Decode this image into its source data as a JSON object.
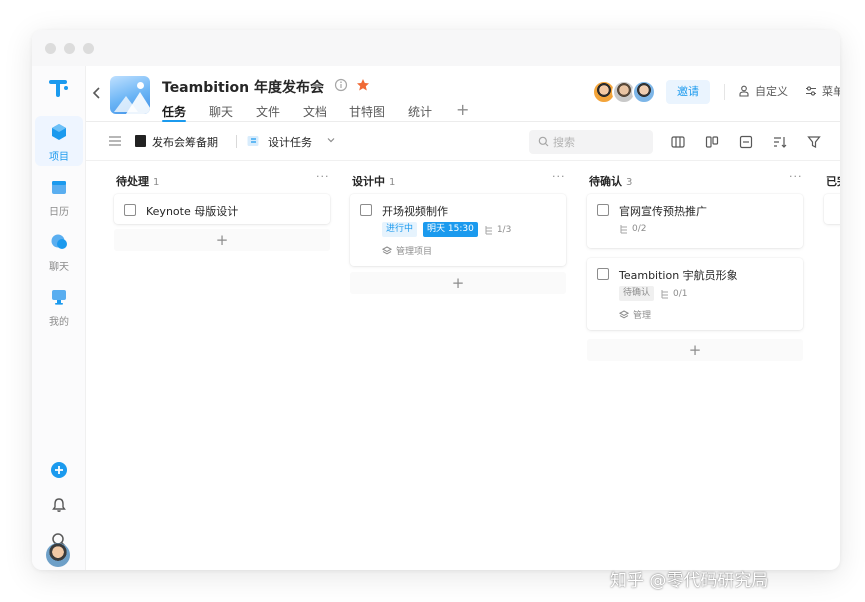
{
  "app": {
    "project_title": "Teambition 年度发布会",
    "tabs": [
      {
        "label": "任务",
        "active": true
      },
      {
        "label": "聊天"
      },
      {
        "label": "文件"
      },
      {
        "label": "文档"
      },
      {
        "label": "甘特图"
      },
      {
        "label": "统计"
      }
    ],
    "invite_label": "邀请",
    "customize_label": "自定义",
    "menu_label": "菜单"
  },
  "sidebar": {
    "items": [
      {
        "label": "项目",
        "icon": "cube-icon",
        "active": true
      },
      {
        "label": "日历",
        "icon": "calendar-icon"
      },
      {
        "label": "聊天",
        "icon": "chat-icon"
      },
      {
        "label": "我的",
        "icon": "monitor-icon"
      }
    ]
  },
  "toolbar": {
    "breadcrumb_1": "发布会筹备期",
    "breadcrumb_2": "设计任务",
    "search_placeholder": "搜索"
  },
  "board": {
    "columns": [
      {
        "name": "待处理",
        "count": "1",
        "cards": [
          {
            "title": "Keynote 母版设计"
          }
        ]
      },
      {
        "name": "设计中",
        "count": "1",
        "cards": [
          {
            "title": "开场视频制作",
            "tags": [
              "进行中",
              "明天 15:30"
            ],
            "subtasks": "1/3",
            "project": "管理项目"
          }
        ]
      },
      {
        "name": "待确认",
        "count": "3",
        "cards": [
          {
            "title": "官网宣传预热推广",
            "subtasks": "0/2"
          },
          {
            "title": "Teambition 宇航员形象",
            "tags": [
              "待确认"
            ],
            "subtasks": "0/1",
            "project": "管理"
          }
        ]
      },
      {
        "name": "已完",
        "count": ""
      }
    ]
  },
  "colors": {
    "accent": "#1b9aee",
    "star": "#f06a35"
  },
  "watermark": "知乎 @零代码研究局"
}
